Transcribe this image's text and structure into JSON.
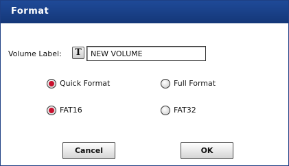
{
  "dialog": {
    "title": "Format",
    "volume_label_caption": "Volume Label:",
    "text_button_glyph": "T",
    "volume_label_value": "NEW VOLUME",
    "format_options": [
      {
        "label": "Quick Format",
        "checked": true
      },
      {
        "label": "Full Format",
        "checked": false
      }
    ],
    "fat_options": [
      {
        "label": "FAT16",
        "checked": true
      },
      {
        "label": "FAT32",
        "checked": false
      }
    ],
    "cancel_label": "Cancel",
    "ok_label": "OK"
  },
  "colors": {
    "title_bar": "#1f4a98",
    "radio_selected": "#c8102e"
  }
}
